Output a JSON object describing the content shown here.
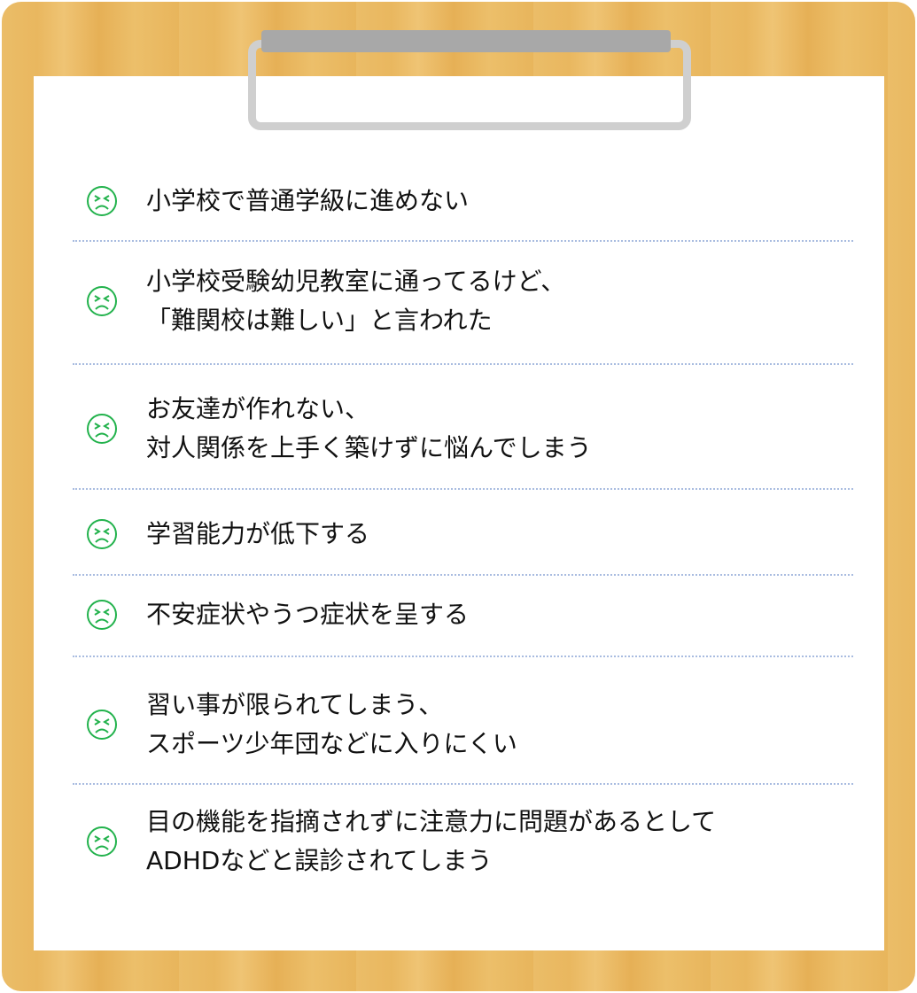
{
  "colors": {
    "icon": "#22b24c",
    "divider": "#a9bce0",
    "board": "#e9b75f"
  },
  "items": [
    {
      "icon": "sad-face-icon",
      "lines": [
        "小学校で普通学級に進めない"
      ]
    },
    {
      "icon": "sad-face-icon",
      "lines": [
        "小学校受験幼児教室に通ってるけど、",
        "「難関校は難しい」と言われた"
      ]
    },
    {
      "icon": "sad-face-icon",
      "lines": [
        "お友達が作れない、",
        "対人関係を上手く築けずに悩んでしまう"
      ]
    },
    {
      "icon": "sad-face-icon",
      "lines": [
        "学習能力が低下する"
      ]
    },
    {
      "icon": "sad-face-icon",
      "lines": [
        "不安症状やうつ症状を呈する"
      ]
    },
    {
      "icon": "sad-face-icon",
      "lines": [
        "習い事が限られてしまう、",
        "スポーツ少年団などに入りにくい"
      ]
    },
    {
      "icon": "sad-face-icon",
      "lines": [
        "目の機能を指摘されずに注意力に問題があるとして",
        "ADHDなどと誤診されてしまう"
      ]
    }
  ]
}
